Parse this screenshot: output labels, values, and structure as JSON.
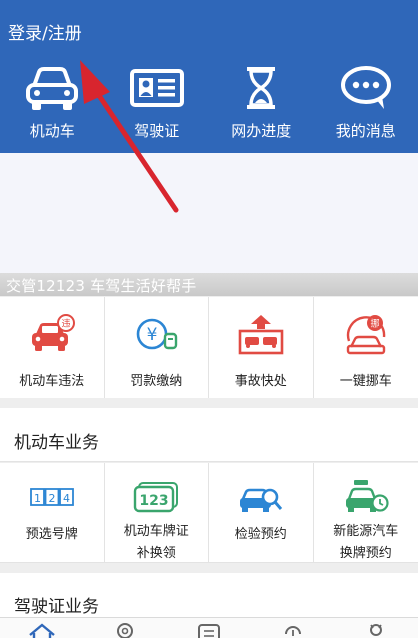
{
  "header": {
    "login_label": "登录/注册",
    "quick_items": [
      {
        "label": "机动车",
        "icon": "car-icon"
      },
      {
        "label": "驾驶证",
        "icon": "license-card-icon"
      },
      {
        "label": "网办进度",
        "icon": "hourglass-icon"
      },
      {
        "label": "我的消息",
        "icon": "chat-bubble-icon"
      }
    ]
  },
  "banner": {
    "slogan": "交管12123 车驾生活好帮手"
  },
  "services": [
    {
      "label": "机动车违法",
      "icon": "car-violation-icon"
    },
    {
      "label": "罚款缴纳",
      "icon": "yuan-payment-icon"
    },
    {
      "label": "事故快处",
      "icon": "accident-icon"
    },
    {
      "label": "一键挪车",
      "icon": "move-car-icon"
    }
  ],
  "vehicle_section": {
    "title": "机动车业务",
    "items": [
      {
        "line1": "预选号牌",
        "line2": "",
        "icon": "plate-select-icon"
      },
      {
        "line1": "机动车牌证",
        "line2": "补换领",
        "icon": "plate-123-icon"
      },
      {
        "line1": "检验预约",
        "line2": "",
        "icon": "inspection-icon"
      },
      {
        "line1": "新能源汽车",
        "line2": "换牌预约",
        "icon": "ev-plate-icon"
      }
    ]
  },
  "license_section": {
    "title": "驾驶证业务"
  },
  "tabbar": {
    "tabs": [
      {
        "icon": "home-icon"
      },
      {
        "icon": "location-icon"
      },
      {
        "icon": "document-icon"
      },
      {
        "icon": "lock-icon"
      },
      {
        "icon": "user-icon"
      }
    ]
  },
  "colors": {
    "header_blue": "#2f67b9",
    "accent_red": "#e14b43",
    "icon_blue": "#2c86d4",
    "icon_green": "#3aa56d",
    "arrow_red": "#d8252e"
  }
}
